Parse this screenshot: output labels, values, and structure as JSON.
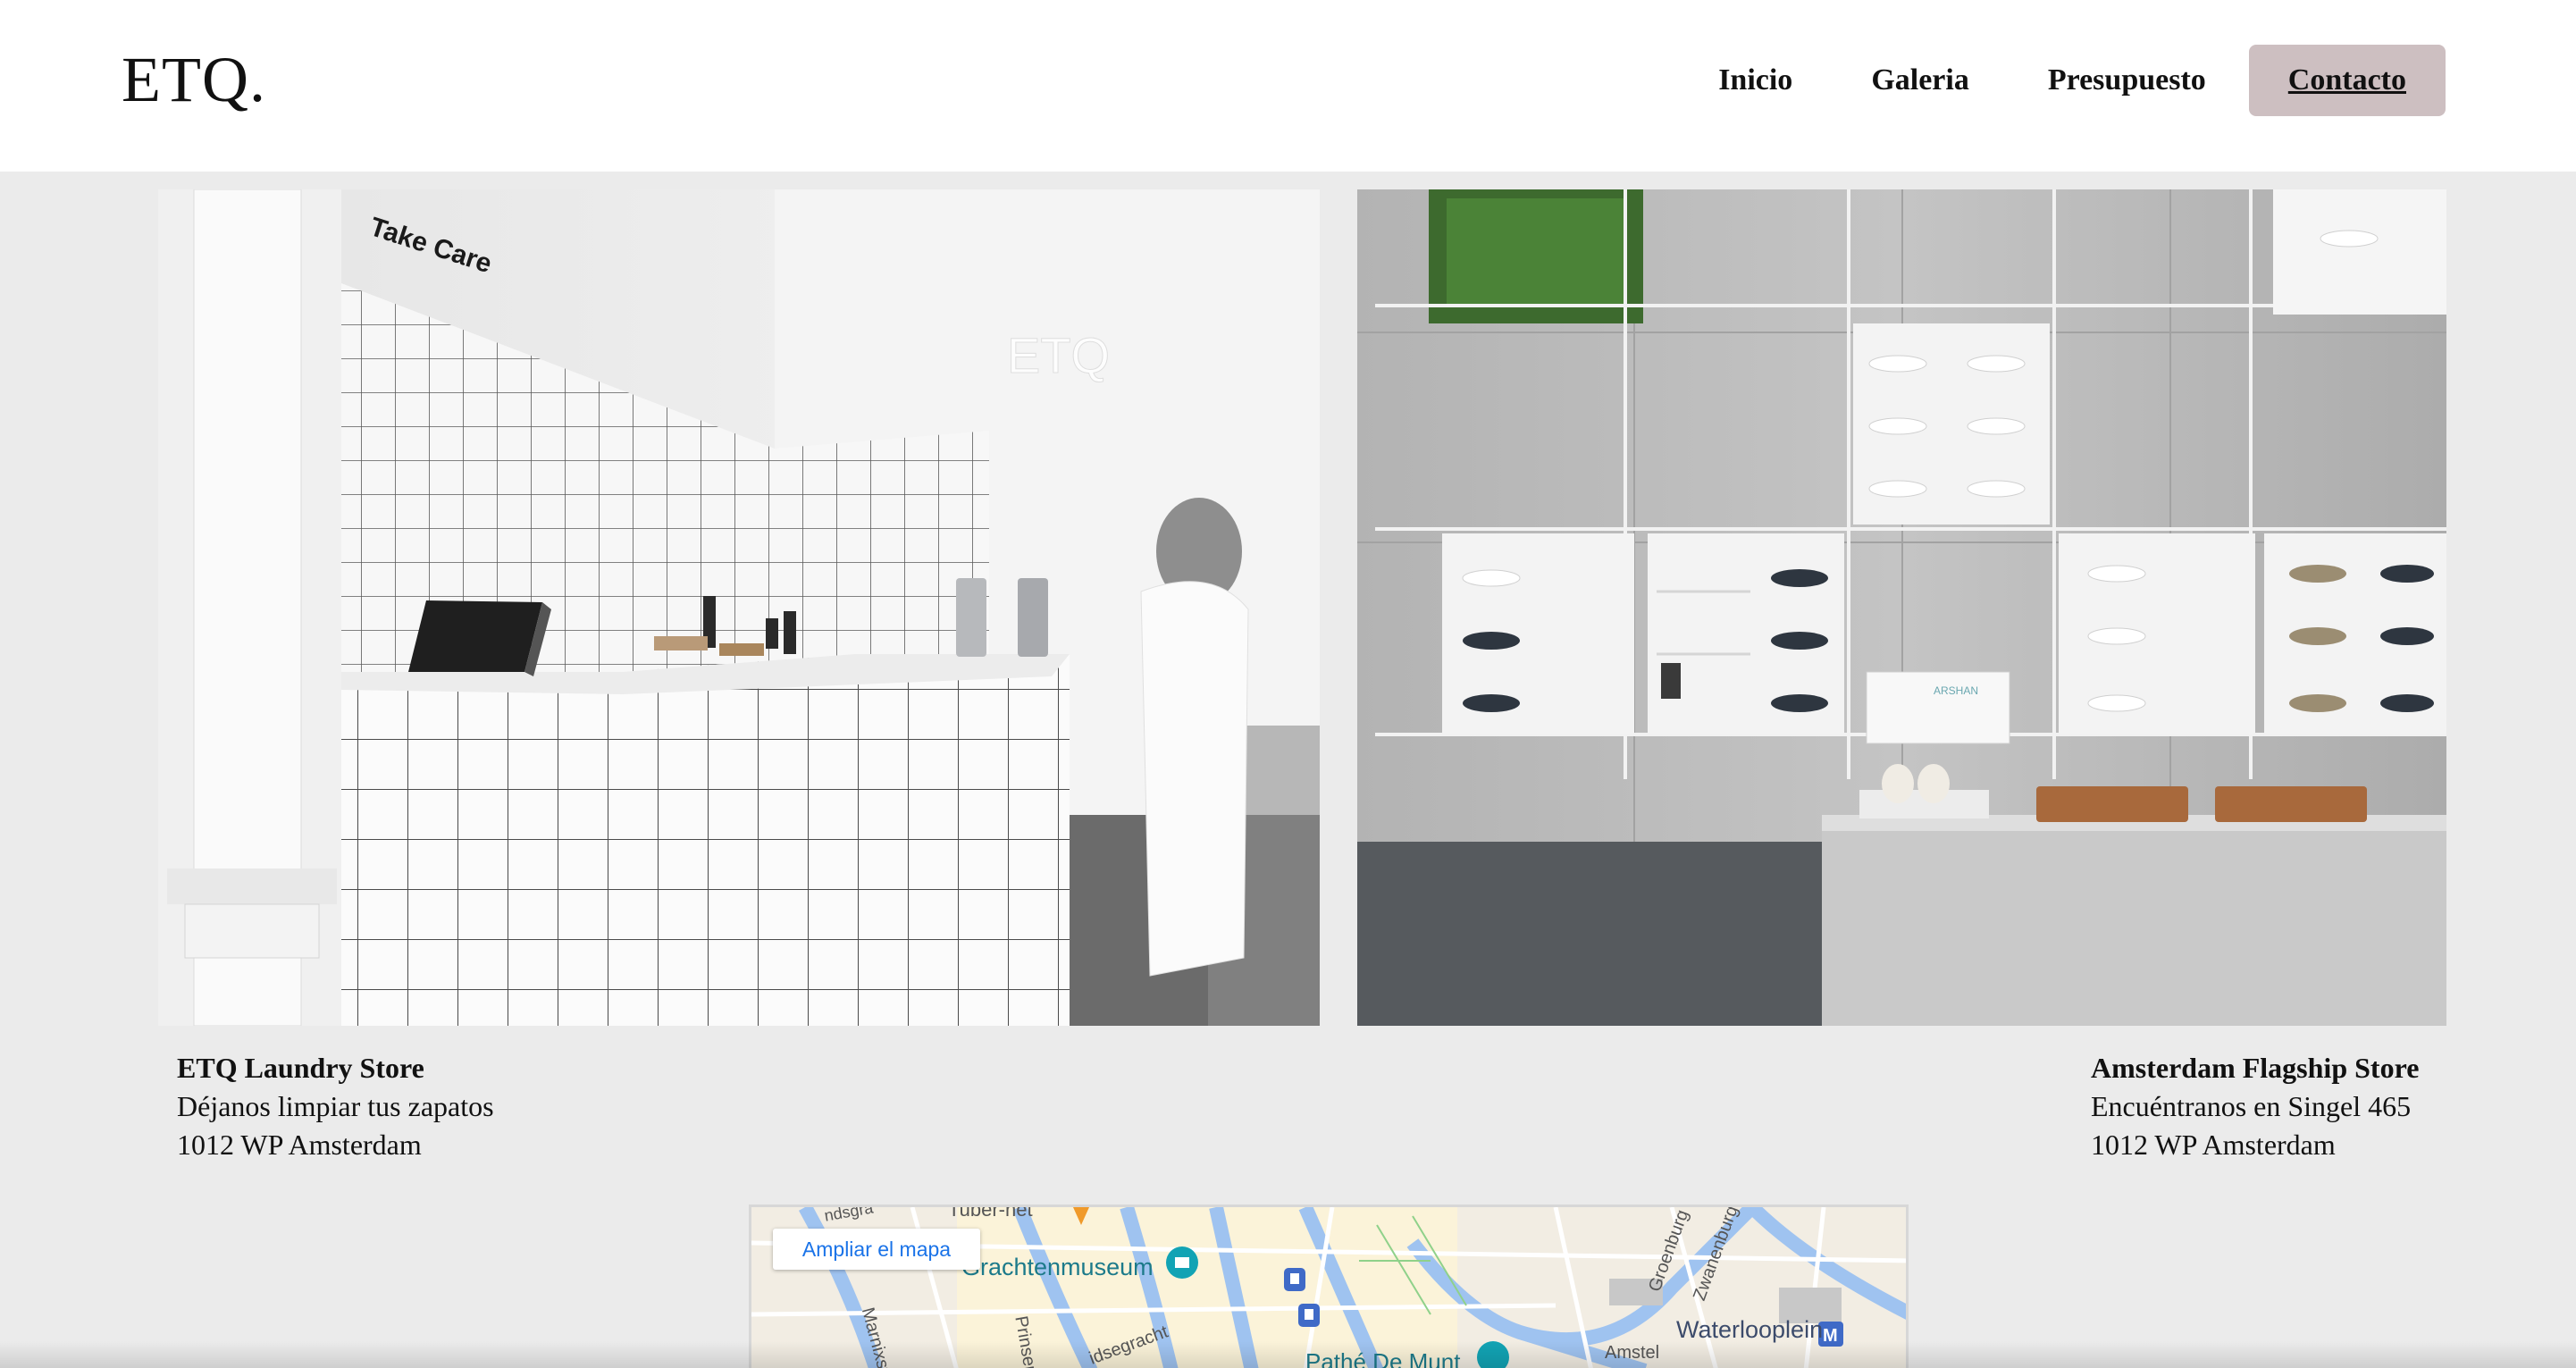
{
  "header": {
    "logo": "ETQ.",
    "nav": [
      {
        "label": "Inicio"
      },
      {
        "label": "Galeria"
      },
      {
        "label": "Presupuesto"
      },
      {
        "label": "Contacto",
        "active": true
      }
    ],
    "active_color": "#cdbfc1"
  },
  "photos": {
    "left_sign": "Take Care",
    "right_book": "ARSHAN"
  },
  "stores": [
    {
      "title": "ETQ Laundry Store",
      "line1": "Déjanos limpiar tus zapatos",
      "line2": "1012 WP Amsterdam"
    },
    {
      "title": "Amsterdam Flagship Store",
      "line1": "Encuéntranos en Singel 465",
      "line2": "1012 WP Amsterdam"
    }
  ],
  "map": {
    "expand_label": "Ampliar el mapa",
    "labels": {
      "grachtenmuseum": "Grachtenmuseum",
      "waterlooplein": "Waterlooplein",
      "pathe": "Pathé De Munt",
      "amstel": "Amstel",
      "prinseng": "Prinseng",
      "marnixstr": "Marnixstr",
      "groenburg": "Groenburg",
      "zwanenburgw": "Zwanenburgw",
      "heisegracht": "idsegracht",
      "typhernet": "Tuber-net",
      "radsgr": "ndsgra"
    },
    "icons": [
      "museum-icon",
      "metro-icon",
      "cinema-icon",
      "pin-icon",
      "transit-icon"
    ]
  }
}
